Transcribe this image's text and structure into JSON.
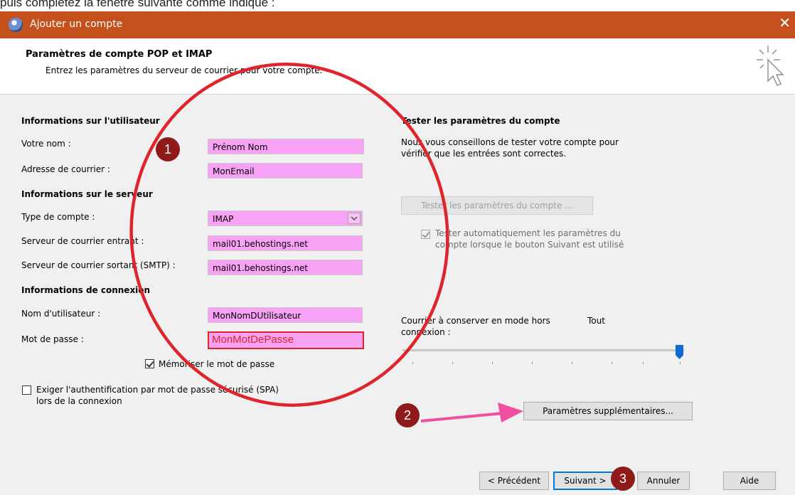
{
  "caption": "puis complétez la fenêtre suivante comme indiqué :",
  "window": {
    "title": "Ajouter un compte",
    "close_glyph": "✕"
  },
  "header": {
    "title": "Paramètres de compte POP et IMAP",
    "subtitle": "Entrez les paramètres du serveur de courrier pour votre compte."
  },
  "user_info": {
    "heading": "Informations sur l'utilisateur",
    "name_label": "Votre nom :",
    "name_value": "Prénom Nom",
    "email_label": "Adresse de courrier :",
    "email_value": "MonEmail"
  },
  "server_info": {
    "heading": "Informations sur le serveur",
    "type_label": "Type de compte :",
    "type_value": "IMAP",
    "incoming_label": "Serveur de courrier entrant :",
    "incoming_value": "mail01.behostings.net",
    "outgoing_label": "Serveur de courrier sortant (SMTP) :",
    "outgoing_value": "mail01.behostings.net"
  },
  "login_info": {
    "heading": "Informations de connexion",
    "username_label": "Nom d'utilisateur :",
    "username_value": "MonNomDUtilisateur",
    "password_label": "Mot de passe :",
    "password_value": "MonMotDePasse",
    "remember_label": "Mémoriser le mot de passe",
    "remember_checked": true,
    "spa_label_line1": "Exiger l'authentification par mot de passe sécurisé (SPA)",
    "spa_label_line2": "lors de la connexion",
    "spa_checked": false
  },
  "test": {
    "heading": "Tester les paramètres du compte",
    "desc_line1": "Nous vous conseillons de tester votre compte pour",
    "desc_line2": "vérifier que les entrées sont correctes.",
    "button_label": "Tester les paramètres du compte ...",
    "auto_line1": "Tester automatiquement les paramètres du",
    "auto_line2": "compte lorsque le bouton Suivant est utilisé",
    "auto_checked": true
  },
  "offline": {
    "label_line1": "Courrier à conserver en mode hors",
    "label_line2": "connexion :",
    "value": "Tout",
    "slider_level": 1.0
  },
  "more_settings_button": "Paramètres supplémentaires...",
  "footer": {
    "prev": "< Précédent",
    "next": "Suivant >",
    "cancel": "Annuler",
    "help": "Aide"
  },
  "annotations": {
    "badge1": "1",
    "badge2": "2",
    "badge3": "3"
  },
  "colors": {
    "titlebar": "#c4511b",
    "field_highlight": "#f8a2f5",
    "circle": "#e0242c",
    "arrow": "#ee4fa0",
    "badge": "#8e1a1a"
  }
}
